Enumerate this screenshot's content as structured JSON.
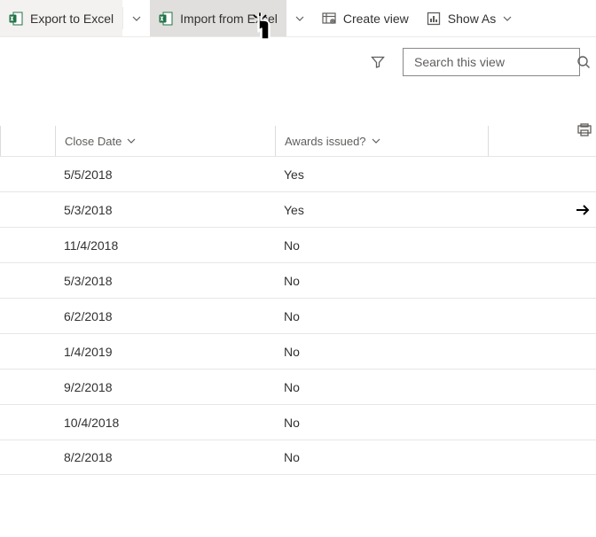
{
  "toolbar": {
    "export_label": "Export to Excel",
    "import_label": "Import from Excel",
    "create_view_label": "Create view",
    "showas_label": "Show As"
  },
  "search": {
    "placeholder": "Search this view"
  },
  "columns": {
    "close_date": "Close Date",
    "awards": "Awards issued?"
  },
  "rows": [
    {
      "close_date": "5/5/2018",
      "awards": "Yes",
      "arrow": false
    },
    {
      "close_date": "5/3/2018",
      "awards": "Yes",
      "arrow": true
    },
    {
      "close_date": "11/4/2018",
      "awards": "No",
      "arrow": false
    },
    {
      "close_date": "5/3/2018",
      "awards": "No",
      "arrow": false
    },
    {
      "close_date": "6/2/2018",
      "awards": "No",
      "arrow": false
    },
    {
      "close_date": "1/4/2019",
      "awards": "No",
      "arrow": false
    },
    {
      "close_date": "9/2/2018",
      "awards": "No",
      "arrow": false
    },
    {
      "close_date": "10/4/2018",
      "awards": "No",
      "arrow": false
    },
    {
      "close_date": "8/2/2018",
      "awards": "No",
      "arrow": false
    }
  ]
}
